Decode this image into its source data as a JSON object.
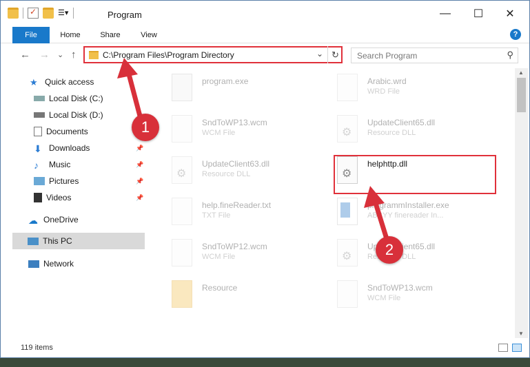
{
  "window": {
    "title": "Program",
    "controls": {
      "minimize": "—",
      "maximize": "☐",
      "close": "✕"
    }
  },
  "ribbon": {
    "tabs": [
      "File",
      "Home",
      "Share",
      "View"
    ],
    "help": "?"
  },
  "nav": {
    "back": "←",
    "forward": "→",
    "recent": "⌄",
    "up": "↑",
    "address": "C:\\Program Files\\Program Directory",
    "address_dropdown": "⌄",
    "refresh": "↻",
    "search_placeholder": "Search Program",
    "search_icon": "⚲"
  },
  "sidebar": {
    "items": [
      {
        "label": "Quick access",
        "icon": "star-icon",
        "pinned": false
      },
      {
        "label": "Local Disk (C:)",
        "icon": "drive-icon",
        "pinned": false
      },
      {
        "label": "Local Disk (D:)",
        "icon": "drive-icon",
        "pinned": false
      },
      {
        "label": "Documents",
        "icon": "document-icon",
        "pinned": false
      },
      {
        "label": "Downloads",
        "icon": "download-icon",
        "pinned": true
      },
      {
        "label": "Music",
        "icon": "music-icon",
        "pinned": true
      },
      {
        "label": "Pictures",
        "icon": "pictures-icon",
        "pinned": true
      },
      {
        "label": "Videos",
        "icon": "video-icon",
        "pinned": true
      },
      {
        "label": "OneDrive",
        "icon": "cloud-icon",
        "pinned": false
      },
      {
        "label": "This PC",
        "icon": "pc-icon",
        "pinned": false,
        "selected": true
      },
      {
        "label": "Network",
        "icon": "network-icon",
        "pinned": false
      }
    ]
  },
  "files": [
    {
      "name": "program.exe",
      "type": "",
      "icon": "exe-icon",
      "faded": true
    },
    {
      "name": "Arabic.wrd",
      "type": "WRD File",
      "icon": "file-icon",
      "faded": true
    },
    {
      "name": "SndToWP13.wcm",
      "type": "WCM File",
      "icon": "file-icon",
      "faded": true
    },
    {
      "name": "UpdateClient65.dll",
      "type": "Resource DLL",
      "icon": "dll-icon",
      "faded": true
    },
    {
      "name": "UpdateClient63.dll",
      "type": "Resource DLL",
      "icon": "dll-icon",
      "faded": true
    },
    {
      "name": "helphttp.dll",
      "type": "",
      "icon": "dll-icon",
      "faded": false,
      "highlighted": true
    },
    {
      "name": "help.fineReader.txt",
      "type": "TXT File",
      "icon": "file-icon",
      "faded": true
    },
    {
      "name": "programmInstaller.exe",
      "type": "ABBYY finereader In...",
      "icon": "installer-icon",
      "faded": true
    },
    {
      "name": "SndToWP12.wcm",
      "type": "WCM File",
      "icon": "file-icon",
      "faded": true
    },
    {
      "name": "UpdateClient65.dll",
      "type": "Resource DLL",
      "icon": "dll-icon",
      "faded": true
    },
    {
      "name": "Resource",
      "type": "",
      "icon": "folder-icon",
      "faded": true
    },
    {
      "name": "SndToWP13.wcm",
      "type": "WCM File",
      "icon": "file-icon",
      "faded": true
    }
  ],
  "status": {
    "item_count": "119 items"
  },
  "annotations": {
    "step1": "1",
    "step2": "2"
  },
  "colors": {
    "accent": "#1979ca",
    "annotation": "#e0303a"
  }
}
